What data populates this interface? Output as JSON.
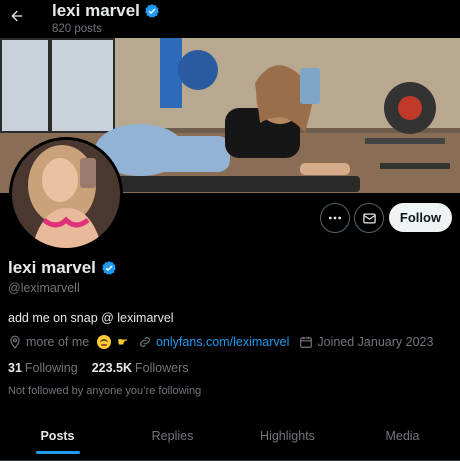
{
  "header": {
    "name": "lexi marvel",
    "post_count": "820 posts",
    "back_icon": "arrow-left-icon",
    "verified_icon": "verified-badge-icon"
  },
  "profile": {
    "name": "lexi marvel",
    "handle": "@leximarvell",
    "bio": "add me on snap @ leximarvel",
    "location": "more of me",
    "website": "onlyfans.com/leximarvel",
    "joined": "Joined January 2023",
    "following_count": "31",
    "following_label": "Following",
    "followers_count": "223.5K",
    "followers_label": "Followers",
    "mutuals_text": "Not followed by anyone you’re following"
  },
  "actions": {
    "more_icon": "more-icon",
    "message_icon": "envelope-icon",
    "follow_label": "Follow"
  },
  "tabs": [
    {
      "label": "Posts",
      "active": true
    },
    {
      "label": "Replies",
      "active": false
    },
    {
      "label": "Highlights",
      "active": false
    },
    {
      "label": "Media",
      "active": false
    }
  ],
  "colors": {
    "accent": "#1d9bf0",
    "text": "#e7e9ea",
    "muted": "#71767b",
    "background": "#000000",
    "follow_button": "#eff3f4"
  }
}
